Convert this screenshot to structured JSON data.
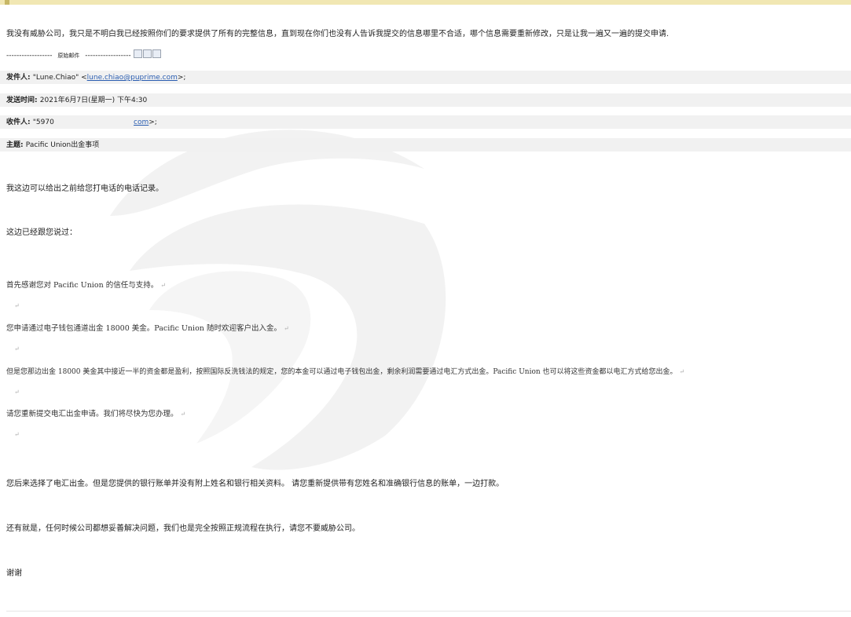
{
  "email": {
    "reply_text": "我没有威胁公司，我只是不明白我已经按照你们的要求提供了所有的完整信息，直到现在你们也没有人告诉我提交的信息哪里不合适，哪个信息需要重新修改，只是让我一遍又一遍的提交申请.",
    "original_divider_left": "------------------",
    "original_divider_label": "原始邮件",
    "original_divider_right": "------------------",
    "from_label": "发件人:",
    "from_name": "\"Lune.Chiao\" <",
    "from_email": "lune.chiao@puprime.com",
    "from_close": ">;",
    "sent_label": "发送时间:",
    "sent_value": "2021年6月7日(星期一) 下午4:30",
    "to_label": "收件人:",
    "to_value_start": "\"5970",
    "to_email_end": "com",
    "to_close": ">;",
    "subject_label": "主题:",
    "subject_value": "Pacific Union出金事项",
    "body": {
      "p1": "我这边可以给出之前给您打电话的电话记录。",
      "p2": "这边已经跟您说过：",
      "quoted": {
        "q1": "首先感谢您对 Pacific Union 的信任与支持。",
        "q2": "您申请通过电子钱包通道出金 18000 美金。Pacific Union 随时欢迎客户出入金。",
        "q3": "但是您那边出金 18000 美金其中接近一半的资金都是盈利，按照国际反洗钱法的规定，您的本金可以通过电子钱包出金，剩余利润需要通过电汇方式出金。Pacific Union 也可以将这些资金都以电汇方式给您出金。",
        "q4": "请您重新提交电汇出金申请。我们将尽快为您办理。"
      },
      "paragraph_mark": "↵",
      "p3": "您后来选择了电汇出金。但是您提供的银行账单并没有附上姓名和银行相关资料。 请您重新提供带有您姓名和准确银行信息的账单，一边打款。",
      "p4": "还有就是，任何时候公司都想妥善解决问题，我们也是完全按照正规流程在执行，请您不要威胁公司。",
      "p5": "谢谢"
    }
  },
  "colors": {
    "top_bar": "#f1e7b3",
    "header_row_bg": "#f1f1f1",
    "link": "#2a5db0"
  }
}
